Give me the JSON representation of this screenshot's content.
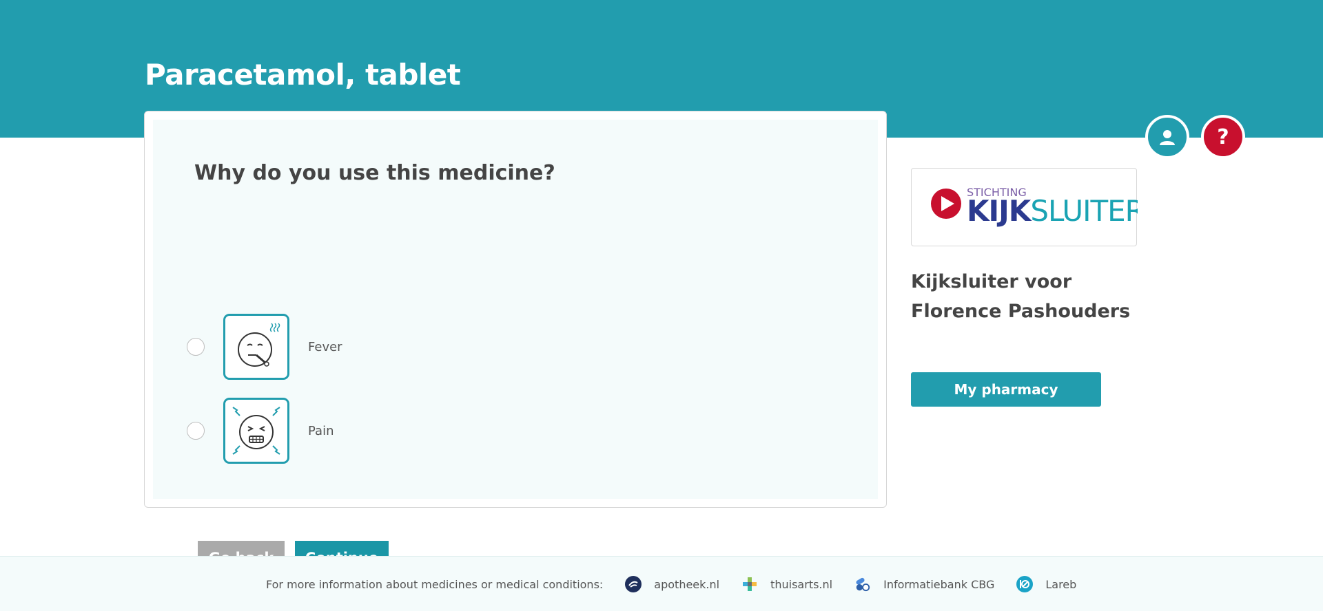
{
  "page": {
    "title": "Paracetamol, tablet"
  },
  "header_actions": {
    "help_label": "?"
  },
  "question": {
    "text": "Why do you use this medicine?",
    "options": [
      {
        "label": "Fever",
        "icon": "fever-face-icon",
        "selected": false
      },
      {
        "label": "Pain",
        "icon": "pain-face-icon",
        "selected": false
      }
    ]
  },
  "actions": {
    "back_label": "Go back",
    "continue_label": "Continue"
  },
  "sidebar": {
    "logo": {
      "small_text": "STICHTING",
      "brand_bold": "KIJK",
      "brand_light": "SLUITER"
    },
    "title": "Kijksluiter voor Florence Pashouders",
    "pharmacy_button": "My pharmacy"
  },
  "footer": {
    "intro": "For more information about medicines or medical conditions:",
    "links": [
      {
        "label": "apotheek.nl",
        "icon": "apotheek-icon"
      },
      {
        "label": "thuisarts.nl",
        "icon": "thuisarts-icon"
      },
      {
        "label": "Informatiebank CBG",
        "icon": "cbg-icon"
      },
      {
        "label": "Lareb",
        "icon": "lareb-icon"
      }
    ]
  },
  "colors": {
    "teal": "#229dae",
    "red": "#c8102e",
    "grey_button": "#aaaaaa",
    "panel_bg": "#f4fbfb"
  }
}
